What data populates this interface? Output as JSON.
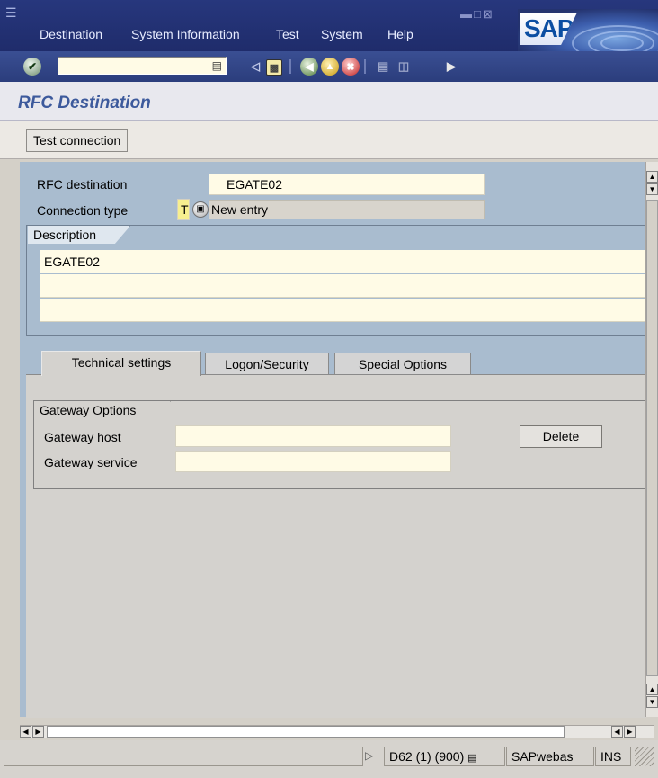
{
  "menubar": {
    "items": [
      {
        "label": "Destination",
        "accel": "D"
      },
      {
        "label": "System Information",
        "accel": ""
      },
      {
        "label": "Test",
        "accel": "T"
      },
      {
        "label": "System",
        "accel": ""
      },
      {
        "label": "Help",
        "accel": "H"
      }
    ],
    "logo_text": "SAP"
  },
  "toolbar": {
    "command_field_value": ""
  },
  "page": {
    "title": "RFC Destination"
  },
  "app_toolbar": {
    "test_connection_label": "Test connection"
  },
  "form": {
    "rfc_destination_label": "RFC destination",
    "rfc_destination_value": "EGATE02",
    "connection_type_label": "Connection type",
    "connection_type_value": "T",
    "connection_type_desc": "New entry"
  },
  "description": {
    "group_label": "Description",
    "lines": [
      "EGATE02",
      "",
      ""
    ]
  },
  "tabs": [
    {
      "label": "Technical settings",
      "active": true
    },
    {
      "label": "Logon/Security",
      "active": false
    },
    {
      "label": "Special Options",
      "active": false
    }
  ],
  "gateway": {
    "group_label": "Gateway Options",
    "host_label": "Gateway host",
    "host_value": "",
    "service_label": "Gateway service",
    "service_value": "",
    "delete_label": "Delete"
  },
  "statusbar": {
    "system": "D62 (1) (900)",
    "server": "SAPwebas",
    "mode": "INS"
  },
  "colors": {
    "menubar": "#27377d",
    "main_area": "#a9bccf",
    "title": "#3d5a9c",
    "input_bg": "#fffbe6"
  }
}
